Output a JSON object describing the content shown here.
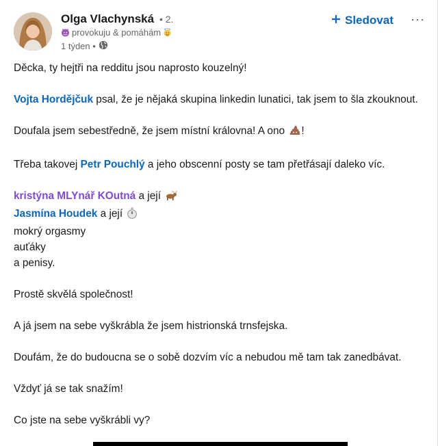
{
  "post": {
    "author": {
      "name": "Olga Vlachynská",
      "degree": "• 2.",
      "headline": "provokuju & pomáhám",
      "time": "1 týden •",
      "avatar_icon": "profile-photo",
      "headline_icons": [
        "smiling-devil-icon",
        "angel-face-icon"
      ]
    },
    "actions": {
      "follow_label": "Sledovat",
      "follow_icon": "plus-icon",
      "more_label": "···"
    },
    "paragraphs": {
      "p1": "Děcka, ty hejtři na redditu jsou naprosto kouzelný!",
      "p2_mention": "Vojta Horděјčuk",
      "p2_text": " psal, že je nějaká skupina linkedin lunatici, tak jsem to šla zkouknout.",
      "p3_text": "Doufala jsem sebestředně, že jsem místní královna! A ono ",
      "p3_end": "!",
      "p4_pre": "Třeba takovej ",
      "p4_mention": "Petr Pouchlý",
      "p4_text": " a jeho obscenní posty se tam přetřásají daleko víc.",
      "list_mention1": "kristýna MLYnář KOutná",
      "list_text1": " a její ",
      "list_mention2": "Jasmína Houdek",
      "list_text2": " a její ",
      "list_line3": "mokrý orgasmy",
      "list_line4": "auťáky",
      "list_line5": "a penisy.",
      "p6": "Prostě skvělá společnost!",
      "p7": "A já jsem na sebe vyškrábla že jsem histrionská trnsfejska.",
      "p8": "Doufám, že do budoucna se o sobě dozvím víc a nebudou mě tam tak zanedbávat.",
      "p9": "Vždyť já se tak snažím!",
      "p10": "Co jste na sebe vyškrábli vy?"
    },
    "icons": [
      "poop-emoji-icon",
      "goat-emoji-icon",
      "stopwatch-emoji-icon",
      "globe-icon"
    ],
    "colors": {
      "link_blue": "#0a66c2",
      "mention_purple": "#7f4ad8",
      "meta_gray": "#666666"
    }
  }
}
